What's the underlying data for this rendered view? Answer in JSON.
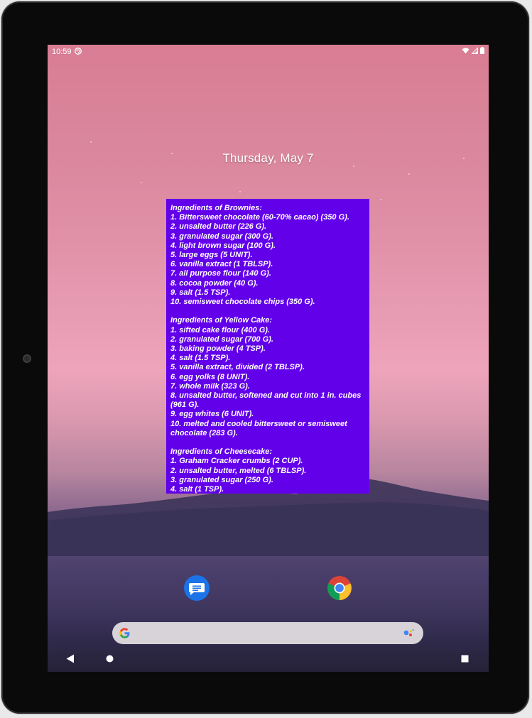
{
  "status_bar": {
    "time": "10:59",
    "left_icon": "sync-icon",
    "right_icons": [
      "wifi-icon",
      "signal-icon",
      "battery-icon"
    ]
  },
  "lockscreen_date": "Thursday, May 7",
  "widget": {
    "background_color": "#6200ea",
    "sections": [
      {
        "title": "Ingredients of Brownies:",
        "items": [
          "1. Bittersweet chocolate (60-70% cacao) (350 G).",
          "2. unsalted butter (226 G).",
          "3. granulated sugar (300 G).",
          "4. light brown sugar (100 G).",
          "5. large eggs (5 UNIT).",
          "6. vanilla extract (1 TBLSP).",
          "7. all purpose flour (140 G).",
          "8. cocoa powder (40 G).",
          "9. salt (1.5 TSP).",
          "10. semisweet chocolate chips (350 G)."
        ]
      },
      {
        "title": "Ingredients of Yellow Cake:",
        "items": [
          "1. sifted cake flour (400 G).",
          "2. granulated sugar (700 G).",
          "3. baking powder (4 TSP).",
          "4. salt (1.5 TSP).",
          "5. vanilla extract, divided (2 TBLSP).",
          "6. egg yolks (8 UNIT).",
          "7. whole milk (323 G).",
          "8. unsalted butter, softened and cut into 1 in. cubes (961 G).",
          "9. egg whites (6 UNIT).",
          "10. melted and cooled bittersweet or semisweet chocolate (283 G)."
        ]
      },
      {
        "title": "Ingredients of Cheesecake:",
        "items": [
          "1. Graham Cracker crumbs (2 CUP).",
          "2. unsalted butter, melted (6 TBLSP).",
          "3. granulated sugar (250 G).",
          "4. salt (1 TSP)."
        ]
      }
    ]
  },
  "dock": {
    "apps": [
      "messages-icon",
      "chrome-icon"
    ]
  },
  "search_bar": {
    "left_icon": "google-g-icon",
    "right_icon": "google-assistant-icon"
  },
  "nav_bar": {
    "buttons": [
      "back-icon",
      "home-icon",
      "recents-icon"
    ]
  }
}
